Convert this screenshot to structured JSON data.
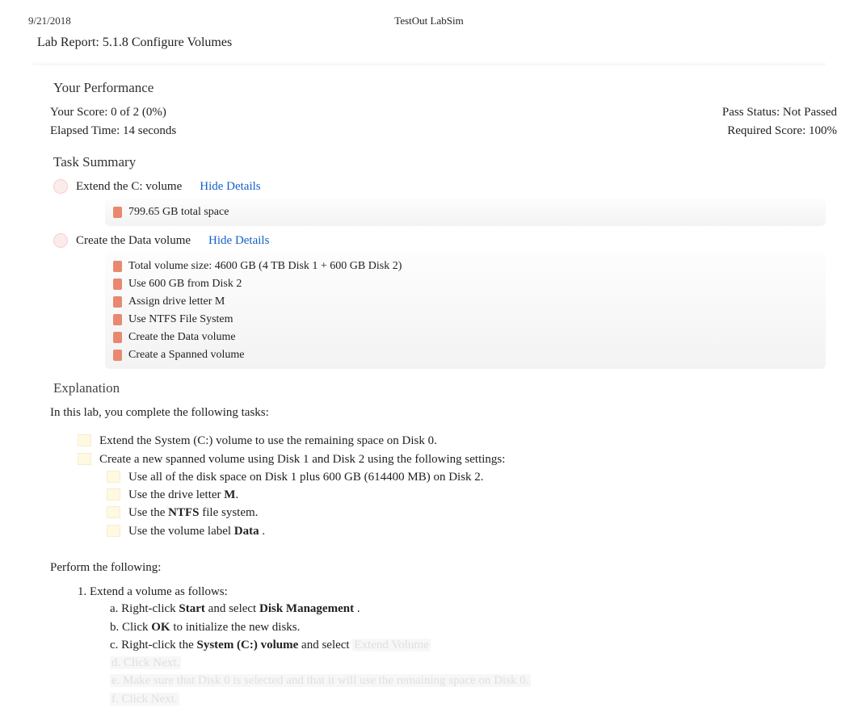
{
  "header": {
    "date": "9/21/2018",
    "center": "TestOut LabSim"
  },
  "report_title": "Lab Report: 5.1.8 Configure Volumes",
  "performance": {
    "heading": "Your Performance",
    "score_label": "Your Score: 0 of 2 (0%)",
    "pass_status": "Pass Status: Not Passed",
    "elapsed": "Elapsed Time: 14 seconds",
    "required": "Required Score: 100%"
  },
  "task_summary": {
    "heading": "Task Summary",
    "task1_text": "Extend the C: volume",
    "task1_link": "Hide Details",
    "task1_details": [
      "799.65 GB total space"
    ],
    "task2_text": "Create the Data volume",
    "task2_link": "Hide Details",
    "task2_details": [
      "Total volume size: 4600 GB (4 TB Disk 1 + 600 GB Disk 2)",
      "Use 600 GB from Disk 2",
      "Assign drive letter M",
      "Use NTFS File System",
      "Create the Data volume",
      "Create a Spanned volume"
    ]
  },
  "explanation": {
    "heading": "Explanation",
    "intro": "In this lab, you complete the following tasks:",
    "item1": "Extend the System (C:) volume to use the remaining space on Disk 0.",
    "item2": "Create a new spanned volume using Disk 1 and Disk 2 using the following settings:",
    "sub1": "Use all of the disk space on Disk 1 plus 600 GB (614400 MB) on Disk 2.",
    "sub2_a": "Use the drive letter ",
    "sub2_b": "M",
    "sub2_c": ".",
    "sub3_a": "Use the ",
    "sub3_b": "NTFS",
    "sub3_c": " file system.",
    "sub4_a": "Use the volume label ",
    "sub4_b": "Data",
    "sub4_c": " .",
    "perform_intro": "Perform the following:",
    "step1_num": "1. ",
    "step1_text": "Extend a volume as follows:",
    "step1a_num": "a. ",
    "step1a_a": "Right-click ",
    "step1a_b": "Start",
    "step1a_c": "  and select ",
    "step1a_d": "Disk Management",
    "step1a_e": "  .",
    "step1b_num": "b. ",
    "step1b_a": "Click ",
    "step1b_b": "OK",
    "step1b_c": " to initialize the new disks.",
    "step1c_num": "c. ",
    "step1c_a": "Right-click the ",
    "step1c_b": "System (C:) volume",
    "step1c_c": "  and select ",
    "step1c_faded": "Extend Volume",
    "step1d_faded": "d. Click Next.",
    "step1e_faded": "e. Make sure that Disk 0 is selected and that it will use the remaining space on Disk 0.",
    "step1f_faded": "f. Click Next."
  }
}
